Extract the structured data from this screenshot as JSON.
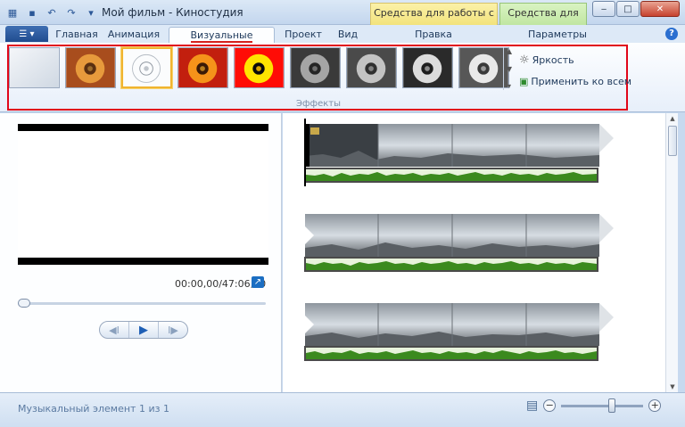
{
  "window": {
    "title": "Мой фильм - Киностудия",
    "context_tab_1": "Средства для работы с видео",
    "context_tab_2": "Средства для ра...",
    "minimize": "‒",
    "maximize": "□",
    "close": "✕"
  },
  "ribbon": {
    "file_button": "☰ ▾",
    "tabs": [
      "Главная",
      "Анимация",
      "Визуальные эффекты",
      "Проект",
      "Вид",
      "Правка",
      "Параметры"
    ],
    "active_tab": "Визуальные эффекты",
    "help": "?",
    "effects_group_label": "Эффекты",
    "brightness_label": "Яркость",
    "apply_all_label": "Применить ко всем",
    "effects_gallery": [
      {
        "name": "none",
        "selected": false
      },
      {
        "name": "sepia",
        "selected": false
      },
      {
        "name": "sketch",
        "selected": true
      },
      {
        "name": "orange",
        "selected": false
      },
      {
        "name": "yellow-red",
        "selected": false
      },
      {
        "name": "grayscale-1",
        "selected": false
      },
      {
        "name": "grayscale-2",
        "selected": false
      },
      {
        "name": "grayscale-3",
        "selected": false
      },
      {
        "name": "grayscale-4",
        "selected": false
      }
    ]
  },
  "preview": {
    "timecode": "00:00,00/47:06,20",
    "expand_icon": "↗"
  },
  "playback": {
    "prev": "◀I",
    "play": "▶",
    "next": "I▶"
  },
  "timeline": {
    "clips": 3
  },
  "status": {
    "text": "Музыкальный элемент 1 из 1",
    "zoom_out": "−",
    "zoom_in": "+",
    "zoom_level_fraction": 0.63
  },
  "colors": {
    "accent_red": "#e1061a",
    "ribbon_bg": "#fdfeff",
    "audio_green": "#3b8a1e"
  }
}
